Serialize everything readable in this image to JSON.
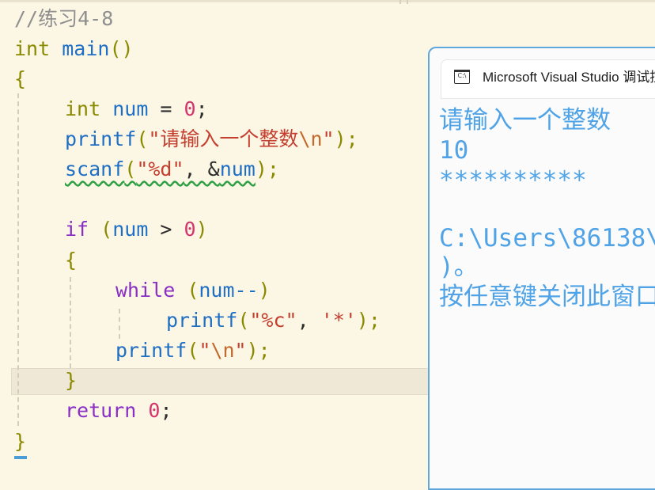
{
  "editor": {
    "lines": [
      [
        {
          "t": "//练习4-8",
          "c": "comment"
        }
      ],
      [
        {
          "t": "int",
          "c": "type"
        },
        {
          "t": " ",
          "c": "op"
        },
        {
          "t": "main",
          "c": "func"
        },
        {
          "t": "()",
          "c": "punc"
        }
      ],
      [
        {
          "t": "{",
          "c": "punc"
        }
      ],
      [
        {
          "t": "int",
          "c": "type"
        },
        {
          "t": " ",
          "c": "op"
        },
        {
          "t": "num",
          "c": "var"
        },
        {
          "t": " = ",
          "c": "op"
        },
        {
          "t": "0",
          "c": "num"
        },
        {
          "t": ";",
          "c": "op"
        }
      ],
      [
        {
          "t": "printf",
          "c": "func"
        },
        {
          "t": "(",
          "c": "punc"
        },
        {
          "t": "\"请输入一个整数",
          "c": "str"
        },
        {
          "t": "\\n",
          "c": "esc"
        },
        {
          "t": "\"",
          "c": "str"
        },
        {
          "t": ");",
          "c": "punc"
        }
      ],
      [
        {
          "t": "scanf",
          "c": "func",
          "sq": true
        },
        {
          "t": "(",
          "c": "punc",
          "sq": true
        },
        {
          "t": "\"%d\"",
          "c": "str",
          "sq": true
        },
        {
          "t": ", &",
          "c": "op",
          "sq": true
        },
        {
          "t": "num",
          "c": "var",
          "sq": true
        },
        {
          "t": ");",
          "c": "punc"
        }
      ],
      [],
      [
        {
          "t": "if",
          "c": "kw"
        },
        {
          "t": " (",
          "c": "punc"
        },
        {
          "t": "num",
          "c": "var"
        },
        {
          "t": " > ",
          "c": "op"
        },
        {
          "t": "0",
          "c": "num"
        },
        {
          "t": ")",
          "c": "punc"
        }
      ],
      [
        {
          "t": "{",
          "c": "punc"
        }
      ],
      [
        {
          "t": "while",
          "c": "kw"
        },
        {
          "t": " (",
          "c": "punc"
        },
        {
          "t": "num--",
          "c": "var"
        },
        {
          "t": ")",
          "c": "punc"
        }
      ],
      [
        {
          "t": "printf",
          "c": "func"
        },
        {
          "t": "(",
          "c": "punc"
        },
        {
          "t": "\"%c\"",
          "c": "str"
        },
        {
          "t": ", ",
          "c": "op"
        },
        {
          "t": "'*'",
          "c": "str"
        },
        {
          "t": ");",
          "c": "punc"
        }
      ],
      [
        {
          "t": "printf",
          "c": "func"
        },
        {
          "t": "(",
          "c": "punc"
        },
        {
          "t": "\"",
          "c": "str"
        },
        {
          "t": "\\n",
          "c": "esc"
        },
        {
          "t": "\"",
          "c": "str"
        },
        {
          "t": ");",
          "c": "punc"
        }
      ],
      [
        {
          "t": "}",
          "c": "punc"
        }
      ],
      [
        {
          "t": "return",
          "c": "kw"
        },
        {
          "t": " ",
          "c": "op"
        },
        {
          "t": "0",
          "c": "num"
        },
        {
          "t": ";",
          "c": "op"
        }
      ],
      [
        {
          "t": "}",
          "c": "punc"
        }
      ]
    ]
  },
  "console": {
    "title": "Microsoft Visual Studio 调试控制台",
    "output": [
      "请输入一个整数",
      "10",
      "**********",
      "",
      "C:\\Users\\86138\\",
      ")。",
      "按任意键关闭此窗口"
    ]
  },
  "colors": {
    "background": "#fcf6e4",
    "console_accent": "#5fa7dd",
    "console_text": "#4fa3e6"
  }
}
